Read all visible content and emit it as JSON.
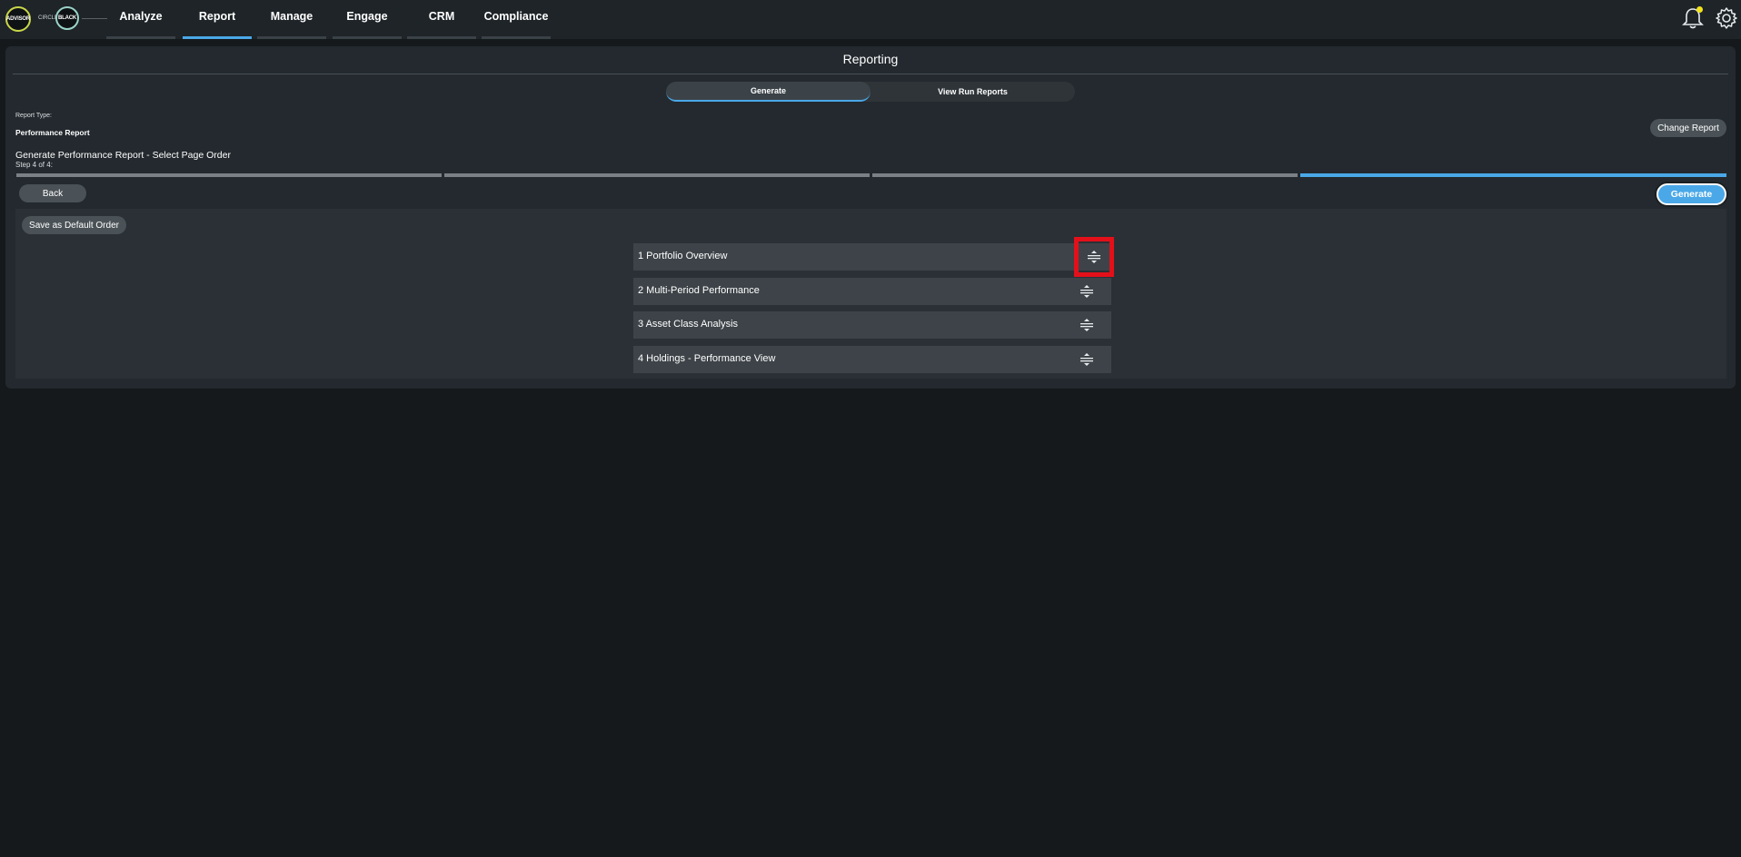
{
  "nav": {
    "logo_left": "ADVISOR",
    "logo_mid": "CIRCLE",
    "logo_right": "BLACK",
    "items": [
      {
        "label": "Analyze",
        "active": false
      },
      {
        "label": "Report",
        "active": true
      },
      {
        "label": "Manage",
        "active": false
      },
      {
        "label": "Engage",
        "active": false
      },
      {
        "label": "CRM",
        "active": false
      },
      {
        "label": "Compliance",
        "active": false
      }
    ]
  },
  "page": {
    "title": "Reporting",
    "tabs": [
      {
        "label": "Generate",
        "active": true
      },
      {
        "label": "View Run Reports",
        "active": false
      }
    ],
    "report_type_label": "Report Type:",
    "report_type_value": "Performance Report",
    "change_report_label": "Change Report",
    "step_title": "Generate Performance Report - Select Page Order",
    "step_subtitle": "Step 4 of 4:",
    "progress": {
      "current_step": 4,
      "total_steps": 4
    },
    "back_label": "Back",
    "generate_label": "Generate",
    "save_default_label": "Save as Default Order",
    "pages": [
      {
        "label": "1 Portfolio Overview"
      },
      {
        "label": "2 Multi-Period Performance"
      },
      {
        "label": "3 Asset Class Analysis"
      },
      {
        "label": "4 Holdings - Performance View"
      }
    ]
  },
  "colors": {
    "accent": "#4aa8e8",
    "notification_dot": "#f2e31b",
    "highlight": "#e3101a"
  }
}
